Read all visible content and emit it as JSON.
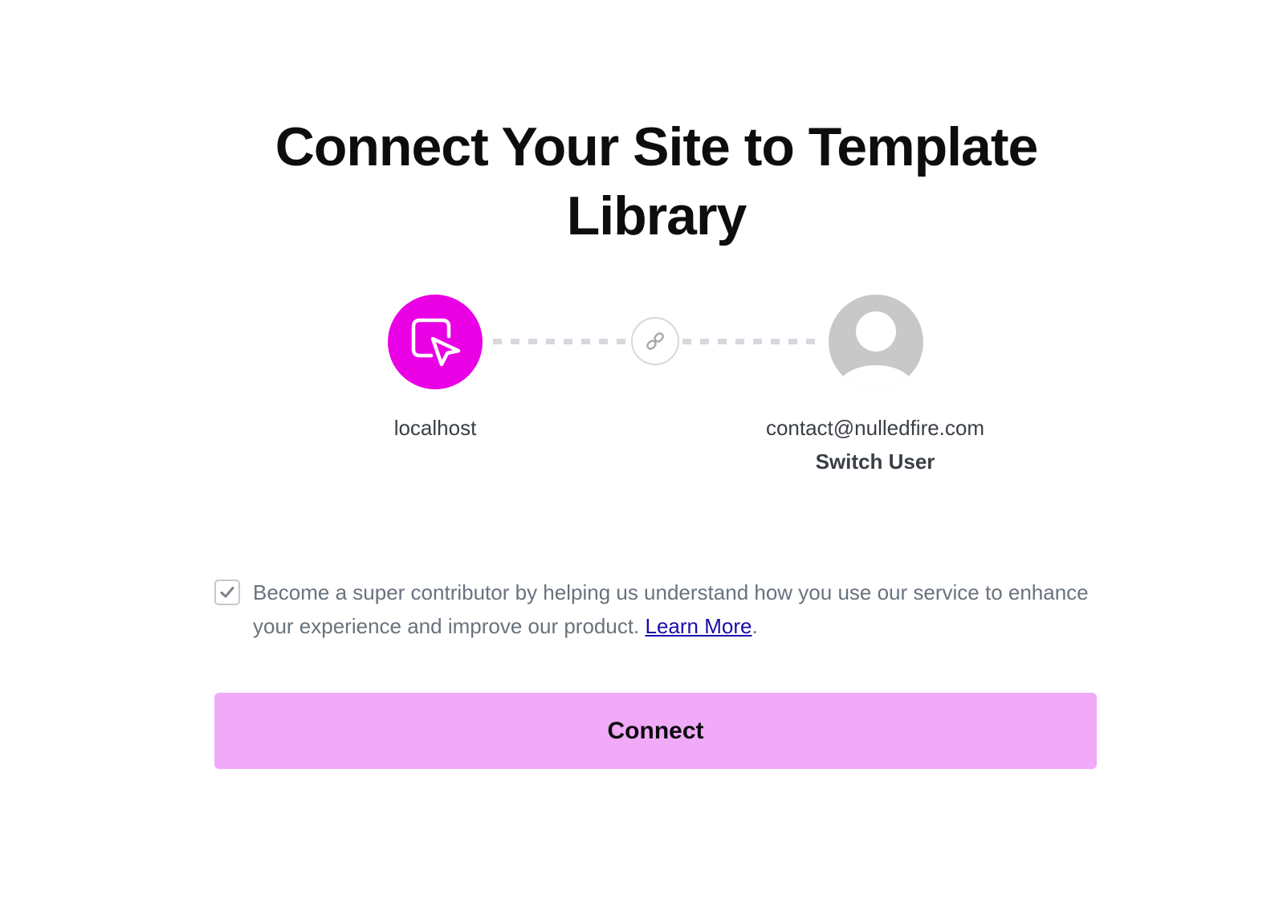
{
  "heading": "Connect Your Site to Template Library",
  "site": {
    "name": "localhost",
    "icon": "cursor-square-icon",
    "color": "#e900e4"
  },
  "link_icon": "link-icon",
  "account": {
    "email": "contact@nulledfire.com",
    "avatar_icon": "default-avatar-icon",
    "switch_label": "Switch User"
  },
  "consent": {
    "checked": true,
    "text": "Become a super contributor by helping us understand how you use our service to enhance your experience and improve our product. ",
    "link_label": "Learn More",
    "suffix": "."
  },
  "connect_button": {
    "label": "Connect",
    "color": "#f1aaf7"
  }
}
